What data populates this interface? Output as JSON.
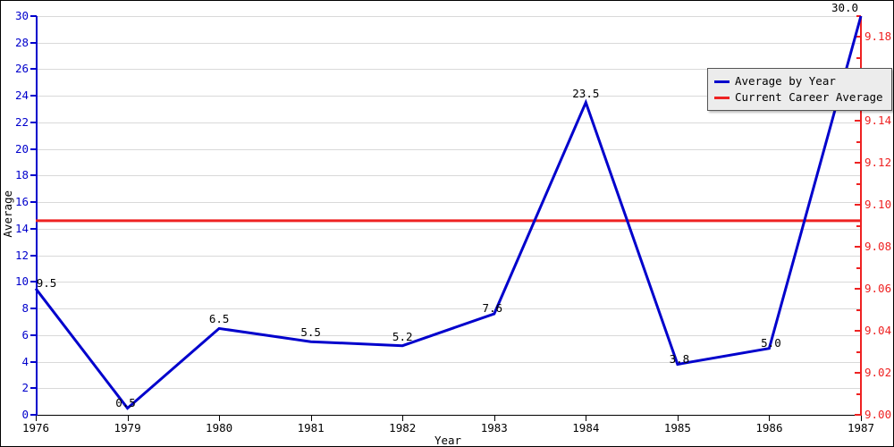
{
  "chart_data": {
    "type": "line",
    "title": "",
    "xlabel": "Year",
    "ylabel": "Average",
    "ylabel_right": "",
    "categories": [
      "1976",
      "1979",
      "1980",
      "1981",
      "1982",
      "1983",
      "1984",
      "1985",
      "1986",
      "1987"
    ],
    "x": [
      1976,
      1979,
      1980,
      1981,
      1982,
      1983,
      1984,
      1985,
      1986,
      1987
    ],
    "ylim": [
      0,
      30
    ],
    "ylim_right": [
      9.0,
      9.19
    ],
    "grid": true,
    "legend_position": "top-right",
    "series": [
      {
        "name": "Average by Year",
        "color": "#0000cc",
        "axis": "left",
        "values": [
          9.5,
          0.5,
          6.5,
          5.5,
          5.2,
          7.6,
          23.5,
          3.8,
          5.0,
          30.0
        ],
        "point_labels": [
          "9.5",
          "0.5",
          "6.5",
          "5.5",
          "5.2",
          "7.6",
          "23.5",
          "3.8",
          "5.0",
          "30.0"
        ]
      },
      {
        "name": "Current Career Average",
        "color": "#ee2222",
        "axis": "left",
        "type": "hline",
        "value": 14.6
      }
    ],
    "y_ticks_left": [
      "0",
      "2",
      "4",
      "6",
      "8",
      "10",
      "12",
      "14",
      "16",
      "18",
      "20",
      "22",
      "24",
      "26",
      "28",
      "30"
    ],
    "y_ticks_right": [
      "9.00",
      "9.02",
      "9.04",
      "9.06",
      "9.08",
      "9.10",
      "9.12",
      "9.14",
      "9.16",
      "9.18"
    ],
    "x_ticks": [
      "1976",
      "1979",
      "1980",
      "1981",
      "1982",
      "1983",
      "1984",
      "1985",
      "1986",
      "1987"
    ]
  },
  "legend": {
    "items": [
      {
        "label": "Average by Year",
        "color": "#0000cc"
      },
      {
        "label": "Current Career Average",
        "color": "#ee2222"
      }
    ]
  },
  "colors": {
    "series_blue": "#0000cc",
    "series_red": "#ee2222",
    "grid": "#d9d9d9",
    "background": "#ffffff",
    "legend_bg": "#ececec"
  }
}
